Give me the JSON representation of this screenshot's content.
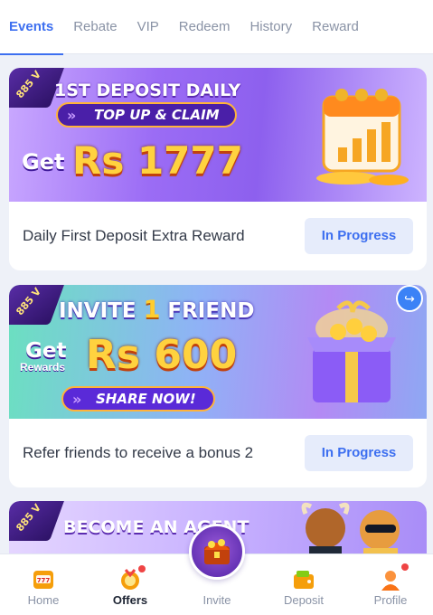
{
  "tabs": [
    "Events",
    "Rebate",
    "VIP",
    "Redeem",
    "History",
    "Reward"
  ],
  "active_tab": "Events",
  "brand_badge": "885 V",
  "cards": [
    {
      "headline": "1ST DEPOSIT DAILY",
      "pill": "TOP UP & CLAIM",
      "get": "Get",
      "amount": "Rs 1777",
      "title": "Daily First Deposit Extra Reward",
      "status": "In Progress"
    },
    {
      "headline_pre": "INVITE ",
      "headline_num": "1",
      "headline_post": " FRIEND",
      "get": "Get",
      "rewards": "Rewards",
      "amount": "Rs 600",
      "pill": "SHARE NOW!",
      "title": "Refer friends to receive a bonus 2",
      "status": "In Progress"
    },
    {
      "headline": "BECOME AN AGENT"
    }
  ],
  "bottom_nav": [
    {
      "label": "Home",
      "icon": "slot-machine-icon"
    },
    {
      "label": "Offers",
      "icon": "medal-icon"
    },
    {
      "label": "Invite",
      "icon": "treasure-chest-icon"
    },
    {
      "label": "Deposit",
      "icon": "wallet-icon"
    },
    {
      "label": "Profile",
      "icon": "user-icon"
    }
  ],
  "active_nav": "Offers",
  "colors": {
    "accent": "#3d6ff0",
    "status_bg": "#e6ecfb",
    "page_bg": "#eef1f8",
    "notification": "#ef4444"
  }
}
